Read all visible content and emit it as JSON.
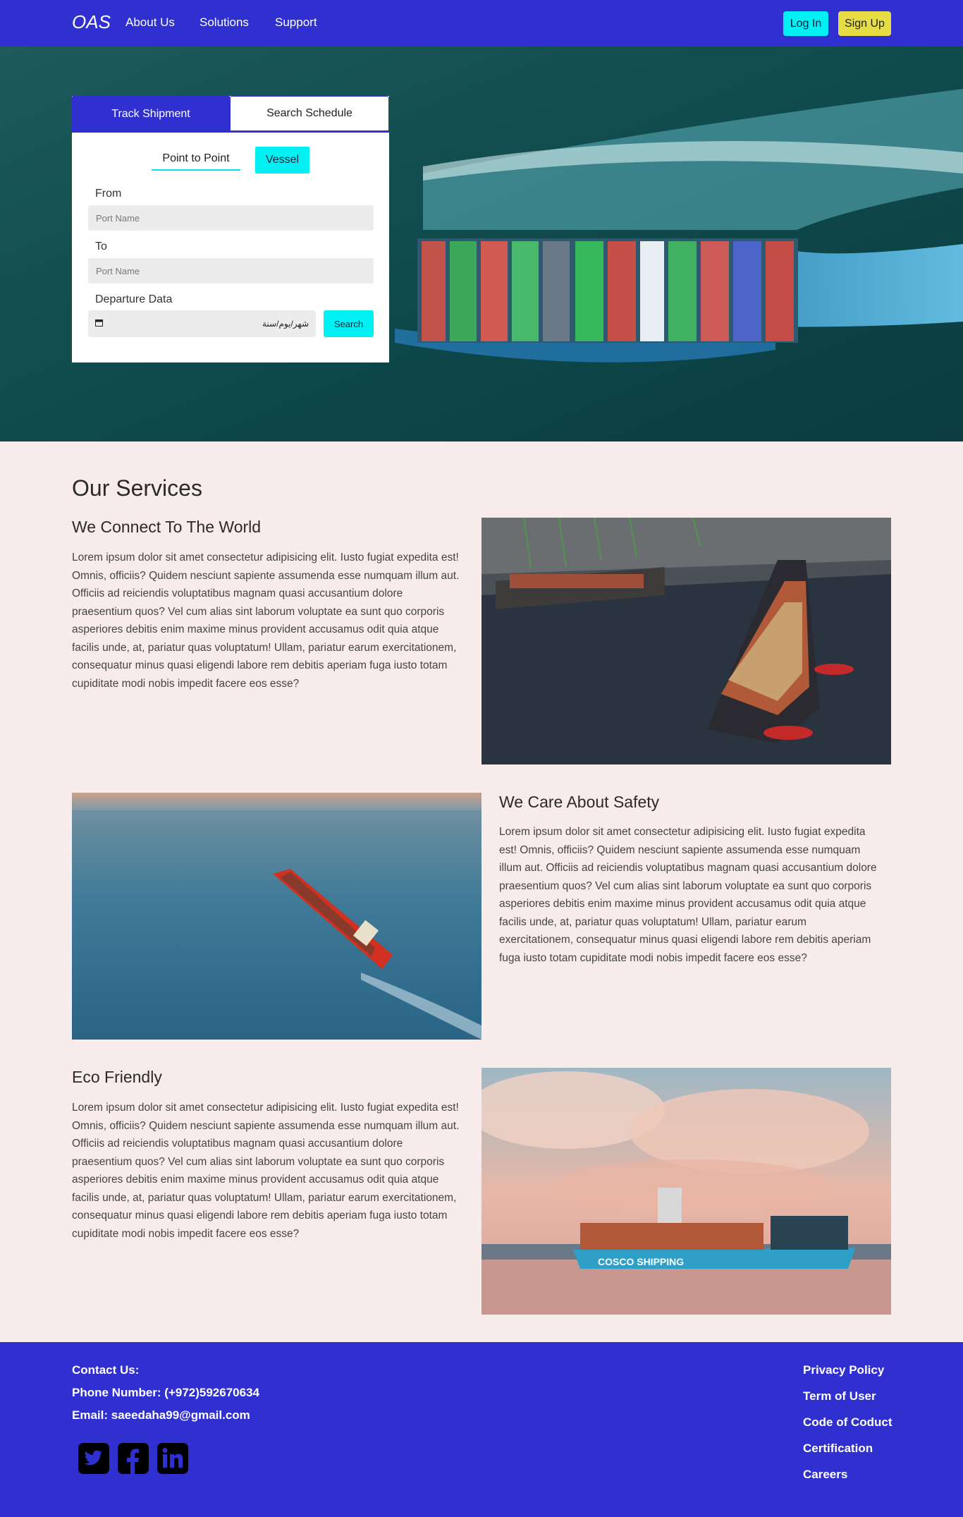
{
  "nav": {
    "brand": "OAS",
    "links": [
      "About Us",
      "Solutions",
      "Support"
    ],
    "login": "Log In",
    "signup": "Sign Up"
  },
  "booking": {
    "tabs": [
      "Track Shipment",
      "Search Schedule"
    ],
    "subtabs": [
      "Point to Point",
      "Vessel"
    ],
    "from_label": "From",
    "from_placeholder": "Port Name",
    "to_label": "To",
    "to_placeholder": "Port Name",
    "date_label": "Departure Data",
    "date_value": "شهر/يوم/سنة",
    "search_button": "Search"
  },
  "services": {
    "title": "Our Services",
    "items": [
      {
        "heading": "We Connect To The World",
        "text": "Lorem ipsum dolor sit amet consectetur adipisicing elit. Iusto fugiat expedita est! Omnis, officiis? Quidem nesciunt sapiente assumenda esse numquam illum aut. Officiis ad reiciendis voluptatibus magnam quasi accusantium dolore praesentium quos? Vel cum alias sint laborum voluptate ea sunt quo corporis asperiores debitis enim maxime minus provident accusamus odit quia atque facilis unde, at, pariatur quas voluptatum! Ullam, pariatur earum exercitationem, consequatur minus quasi eligendi labore rem debitis aperiam fuga iusto totam cupiditate modi nobis impedit facere eos esse?"
      },
      {
        "heading": "We Care About Safety",
        "text": "Lorem ipsum dolor sit amet consectetur adipisicing elit. Iusto fugiat expedita est! Omnis, officiis? Quidem nesciunt sapiente assumenda esse numquam illum aut. Officiis ad reiciendis voluptatibus magnam quasi accusantium dolore praesentium quos? Vel cum alias sint laborum voluptate ea sunt quo corporis asperiores debitis enim maxime minus provident accusamus odit quia atque facilis unde, at, pariatur quas voluptatum! Ullam, pariatur earum exercitationem, consequatur minus quasi eligendi labore rem debitis aperiam fuga iusto totam cupiditate modi nobis impedit facere eos esse?"
      },
      {
        "heading": "Eco Friendly",
        "text": "Lorem ipsum dolor sit amet consectetur adipisicing elit. Iusto fugiat expedita est! Omnis, officiis? Quidem nesciunt sapiente assumenda esse numquam illum aut. Officiis ad reiciendis voluptatibus magnam quasi accusantium dolore praesentium quos? Vel cum alias sint laborum voluptate ea sunt quo corporis asperiores debitis enim maxime minus provident accusamus odit quia atque facilis unde, at, pariatur quas voluptatum! Ullam, pariatur earum exercitationem, consequatur minus quasi eligendi labore rem debitis aperiam fuga iusto totam cupiditate modi nobis impedit facere eos esse?"
      }
    ],
    "ship_hull_text": "COSCO SHIPPING"
  },
  "footer": {
    "contact_title": "Contact Us:",
    "phone": "Phone Number: (+972)592670634",
    "email": "Email: saeedaha99@gmail.com",
    "social_icons": [
      "twitter-icon",
      "facebook-icon",
      "linkedin-icon"
    ],
    "links": [
      "Privacy Policy",
      "Term of User",
      "Code of Coduct",
      "Certification",
      "Careers"
    ]
  },
  "colors": {
    "primary": "#3030d0",
    "accent_cyan": "#00f0f4",
    "accent_yellow": "#e6dc46",
    "page_bg": "#f7eceb"
  }
}
